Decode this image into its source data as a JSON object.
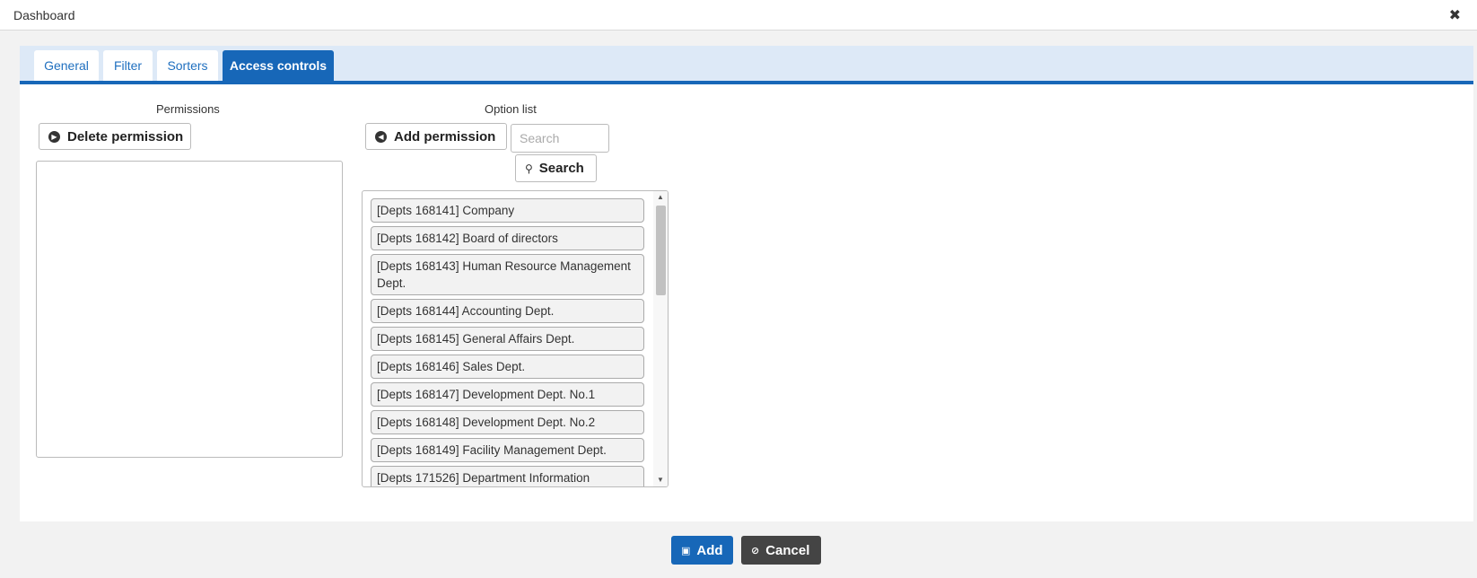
{
  "window": {
    "title": "Dashboard",
    "close_glyph": "✖"
  },
  "tabs": [
    {
      "label": "General"
    },
    {
      "label": "Filter"
    },
    {
      "label": "Sorters"
    },
    {
      "label": "Access controls",
      "active": true
    }
  ],
  "permissions": {
    "label": "Permissions",
    "delete_button": "Delete permission",
    "delete_icon": "circle-arrow-right-icon"
  },
  "options": {
    "label": "Option list",
    "add_button": "Add permission",
    "add_icon": "circle-arrow-left-icon",
    "search_placeholder": "Search",
    "search_button": "Search",
    "search_icon": "magnifier-icon",
    "items": [
      {
        "label": "[Depts 168141] Company"
      },
      {
        "label": "[Depts 168142] Board of directors"
      },
      {
        "label": "[Depts 168143] Human Resource Management Dept."
      },
      {
        "label": "[Depts 168144] Accounting Dept."
      },
      {
        "label": "[Depts 168145] General Affairs Dept."
      },
      {
        "label": "[Depts 168146] Sales Dept."
      },
      {
        "label": "[Depts 168147] Development Dept. No.1"
      },
      {
        "label": "[Depts 168148] Development Dept. No.2"
      },
      {
        "label": "[Depts 168149] Facility Management Dept."
      },
      {
        "label": "[Depts 171526] Department Information"
      }
    ]
  },
  "footer": {
    "add_button": "Add",
    "add_icon": "save-icon",
    "cancel_button": "Cancel",
    "cancel_icon": "ban-icon"
  },
  "colors": {
    "accent": "#1767b8",
    "tabbar_bg": "#dde9f7",
    "cancel_bg": "#444444"
  }
}
